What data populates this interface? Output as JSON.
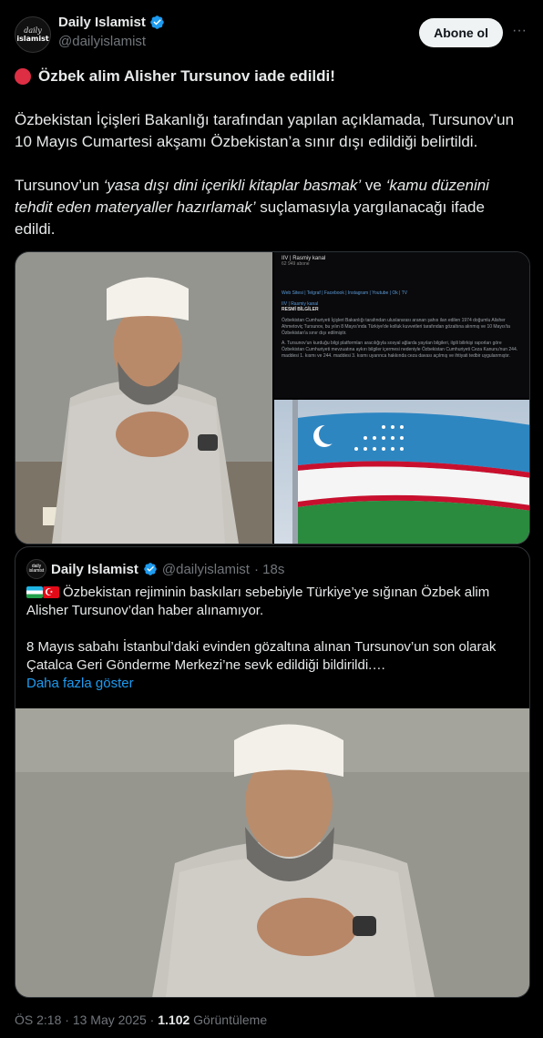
{
  "author": {
    "display_name": "Daily Islamist",
    "handle": "@dailyislamist",
    "avatar_text_1": "daily",
    "avatar_text_2": "islamist"
  },
  "actions": {
    "follow_label": "Abone ol",
    "more_icon": "more-horizontal-icon"
  },
  "tweet": {
    "title": "Özbek alim Alisher Tursunov iade edildi!",
    "para1": "Özbekistan İçişleri Bakanlığı tarafından yapılan açıklamada, Tursunov’un 10 Mayıs Cumartesi akşamı Özbekistan’a sınır dışı edildiği belirtildi.",
    "para2_prefix": "Tursunov’un ",
    "para2_italic1": "‘yasa dışı dini içerikli kitaplar basmak’",
    "para2_mid": " ve ",
    "para2_italic2": "‘kamu düzenini tehdit eden materyaller hazırlamak’",
    "para2_suffix": " suçlamasıyla yargılanacağı ifade edildi."
  },
  "media": {
    "screenshot": {
      "channel": "IIV | Rasmiy kanal",
      "subscribers": "62 949 abone",
      "links": "Web Sitesi | Telgraf | Facebook | Instagram | Youtube | Ok | TV",
      "post_channel": "IIV | Rasmiy kanal",
      "post_heading": "RESMİ BİLGİLER",
      "post_body1": "Özbekistan Cumhuriyeti İçişleri Bakanlığı tarafından uluslararası aranan şahıs ilan edilen 1974 doğumlu Alisher Ahmetoviç Tursunov, bu yılın 8 Mayıs'ında Türkiye'de kolluk kuvvetleri tarafından gözaltına alınmış ve 10 Mayıs'ta Özbekistan'a sınır dışı edilmiştir.",
      "post_body2": "A. Tursunov'un kurduğu bilgi platformları aracılığıyla sosyal ağlarda yayılan bilgileri, ilgili bilirkişi raporları göre Özbekistan Cumhuriyeti mevzuatına aykırı bilgiler içermesi nedeniyle Özbekistan Cumhuriyeti Ceza Kanunu'nun 244. maddesi 1. kısmı ve 244. maddesi 3. kısmı uyarınca hakkında ceza davası açılmış ve ihtiyati tedbir uygulanmıştır."
    }
  },
  "quote": {
    "display_name": "Daily Islamist",
    "handle": "@dailyislamist",
    "time": "· 18s",
    "para1": "Özbekistan rejiminin baskıları sebebiyle Türkiye’ye sığınan Özbek alim Alisher Tursunov’dan haber alınamıyor.",
    "para2": "8 Mayıs sabahı İstanbul’daki evinden gözaltına alınan Tursunov’un son olarak Çatalca Geri Gönderme Merkezi’ne sevk edildiği bildirildi.…",
    "show_more": "Daha fazla göster"
  },
  "meta": {
    "time": "ÖS 2:18",
    "sep1": " · ",
    "date": "13 May 2025",
    "sep2": " · ",
    "views": "1.102",
    "views_label": " Görüntüleme"
  },
  "colors": {
    "background": "#000000",
    "text": "#e7e9ea",
    "muted": "#71767b",
    "link": "#1d9bf0",
    "verified": "#1d9bf0"
  }
}
